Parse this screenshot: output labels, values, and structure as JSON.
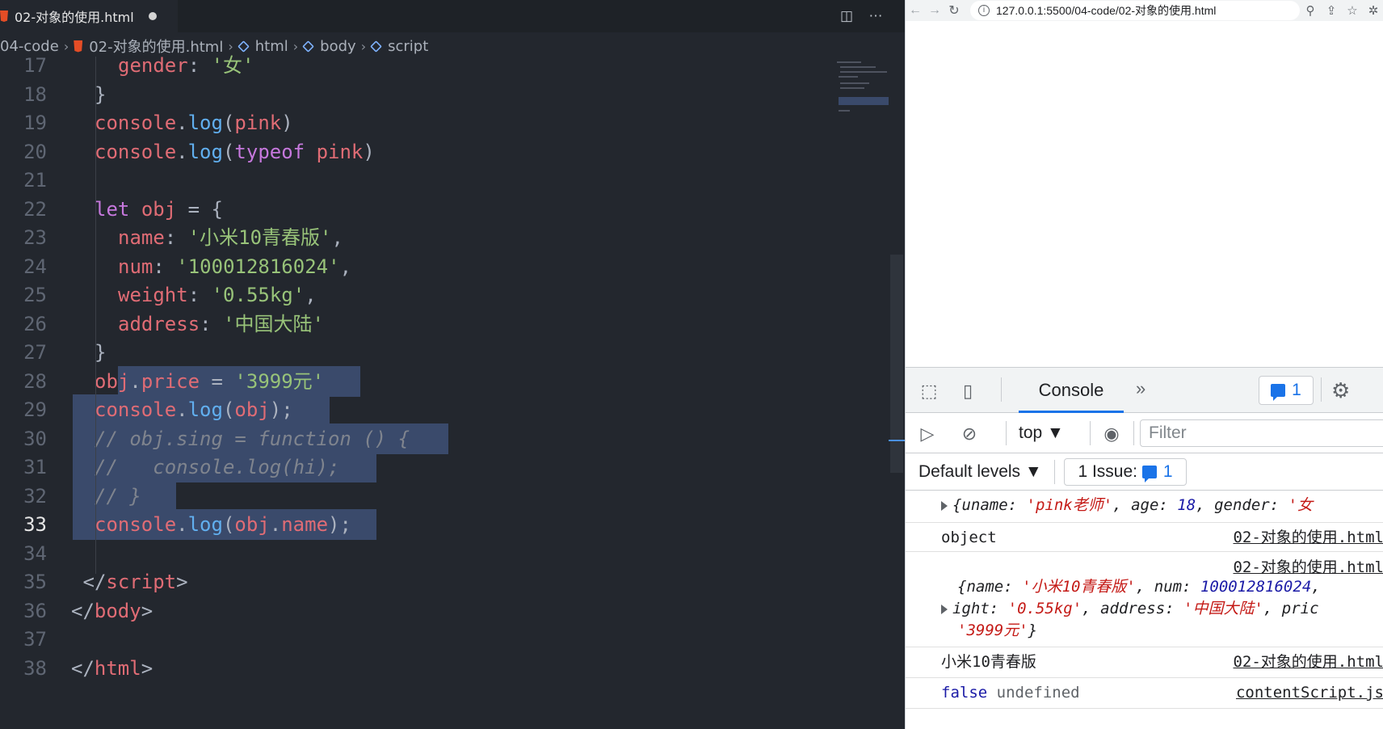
{
  "editor": {
    "tab_title": "02-对象的使用.html",
    "breadcrumb": [
      "04-code",
      "02-对象的使用.html",
      "html",
      "body",
      "script"
    ],
    "lines": [
      {
        "n": "17",
        "tokens": [
          [
            "v",
            "gender"
          ],
          [
            "p",
            ": "
          ],
          [
            "s",
            "'女'"
          ]
        ],
        "indent": 2
      },
      {
        "n": "18",
        "tokens": [
          [
            "p",
            "}"
          ]
        ],
        "indent": 1
      },
      {
        "n": "19",
        "tokens": [
          [
            "v",
            "console"
          ],
          [
            "p",
            "."
          ],
          [
            "f",
            "log"
          ],
          [
            "p",
            "("
          ],
          [
            "v",
            "pink"
          ],
          [
            "p",
            ")"
          ]
        ],
        "indent": 1
      },
      {
        "n": "20",
        "tokens": [
          [
            "v",
            "console"
          ],
          [
            "p",
            "."
          ],
          [
            "f",
            "log"
          ],
          [
            "p",
            "("
          ],
          [
            "k",
            "typeof"
          ],
          [
            "p",
            " "
          ],
          [
            "v",
            "pink"
          ],
          [
            "p",
            ")"
          ]
        ],
        "indent": 1
      },
      {
        "n": "21",
        "tokens": [],
        "indent": 1
      },
      {
        "n": "22",
        "tokens": [
          [
            "k",
            "let"
          ],
          [
            "p",
            " "
          ],
          [
            "v",
            "obj"
          ],
          [
            "p",
            " = {"
          ]
        ],
        "indent": 1
      },
      {
        "n": "23",
        "tokens": [
          [
            "v",
            "name"
          ],
          [
            "p",
            ": "
          ],
          [
            "s",
            "'小米10青春版'"
          ],
          [
            "p",
            ","
          ]
        ],
        "indent": 2
      },
      {
        "n": "24",
        "tokens": [
          [
            "v",
            "num"
          ],
          [
            "p",
            ": "
          ],
          [
            "s",
            "'100012816024'"
          ],
          [
            "p",
            ","
          ]
        ],
        "indent": 2
      },
      {
        "n": "25",
        "tokens": [
          [
            "v",
            "weight"
          ],
          [
            "p",
            ": "
          ],
          [
            "s",
            "'0.55kg'"
          ],
          [
            "p",
            ","
          ]
        ],
        "indent": 2
      },
      {
        "n": "26",
        "tokens": [
          [
            "v",
            "address"
          ],
          [
            "p",
            ": "
          ],
          [
            "s",
            "'中国大陆'"
          ]
        ],
        "indent": 2
      },
      {
        "n": "27",
        "tokens": [
          [
            "p",
            "}"
          ]
        ],
        "indent": 1
      },
      {
        "n": "28",
        "tokens": [
          [
            "v",
            "obj"
          ],
          [
            "p",
            "."
          ],
          [
            "v",
            "price"
          ],
          [
            "p",
            " = "
          ],
          [
            "s",
            "'3999元'"
          ]
        ],
        "indent": 1
      },
      {
        "n": "29",
        "tokens": [
          [
            "v",
            "console"
          ],
          [
            "p",
            "."
          ],
          [
            "f",
            "log"
          ],
          [
            "p",
            "("
          ],
          [
            "v",
            "obj"
          ],
          [
            "p",
            ");"
          ]
        ],
        "indent": 1
      },
      {
        "n": "30",
        "tokens": [
          [
            "c",
            "// obj.sing = function () {"
          ]
        ],
        "indent": 1
      },
      {
        "n": "31",
        "tokens": [
          [
            "c",
            "//   console.log(hi);"
          ]
        ],
        "indent": 1
      },
      {
        "n": "32",
        "tokens": [
          [
            "c",
            "// }"
          ]
        ],
        "indent": 1
      },
      {
        "n": "33",
        "tokens": [
          [
            "v",
            "console"
          ],
          [
            "p",
            "."
          ],
          [
            "f",
            "log"
          ],
          [
            "p",
            "("
          ],
          [
            "v",
            "obj"
          ],
          [
            "p",
            "."
          ],
          [
            "v",
            "name"
          ],
          [
            "p",
            ");"
          ]
        ],
        "indent": 1
      },
      {
        "n": "34",
        "tokens": [],
        "indent": 1
      },
      {
        "n": "35",
        "tokens": [
          [
            "p",
            "</"
          ],
          [
            "t",
            "script"
          ],
          [
            "p",
            ">"
          ]
        ],
        "indent": 0.5
      },
      {
        "n": "36",
        "tokens": [
          [
            "p",
            "</"
          ],
          [
            "t",
            "body"
          ],
          [
            "p",
            ">"
          ]
        ],
        "indent": 0
      },
      {
        "n": "37",
        "tokens": [],
        "indent": 0
      },
      {
        "n": "38",
        "tokens": [
          [
            "p",
            "</"
          ],
          [
            "t",
            "html"
          ],
          [
            "p",
            ">"
          ]
        ],
        "indent": 0
      }
    ],
    "active_line": "33"
  },
  "browser": {
    "url": "127.0.0.1:5500/04-code/02-对象的使用.html"
  },
  "devtools": {
    "tab_console": "Console",
    "issues_count": "1",
    "context": "top",
    "filter_placeholder": "Filter",
    "levels": "Default levels",
    "issue_label": "1 Issue:",
    "issue_count": "1",
    "messages": {
      "m1": "{uname: 'pink老师', age: 18, gender: '女",
      "m2_text": "object",
      "m2_src": "02-对象的使用.html",
      "m3_src": "02-对象的使用.html",
      "m3_l1": "{name: '小米10青春版', num: 100012816024,",
      "m3_l2": "ight: '0.55kg', address: '中国大陆', pric",
      "m3_l3": "'3999元'}",
      "m4_text": "小米10青春版",
      "m4_src": "02-对象的使用.html",
      "m5_kw": "false",
      "m5_text": "undefined",
      "m5_src": "contentScript.js"
    }
  }
}
